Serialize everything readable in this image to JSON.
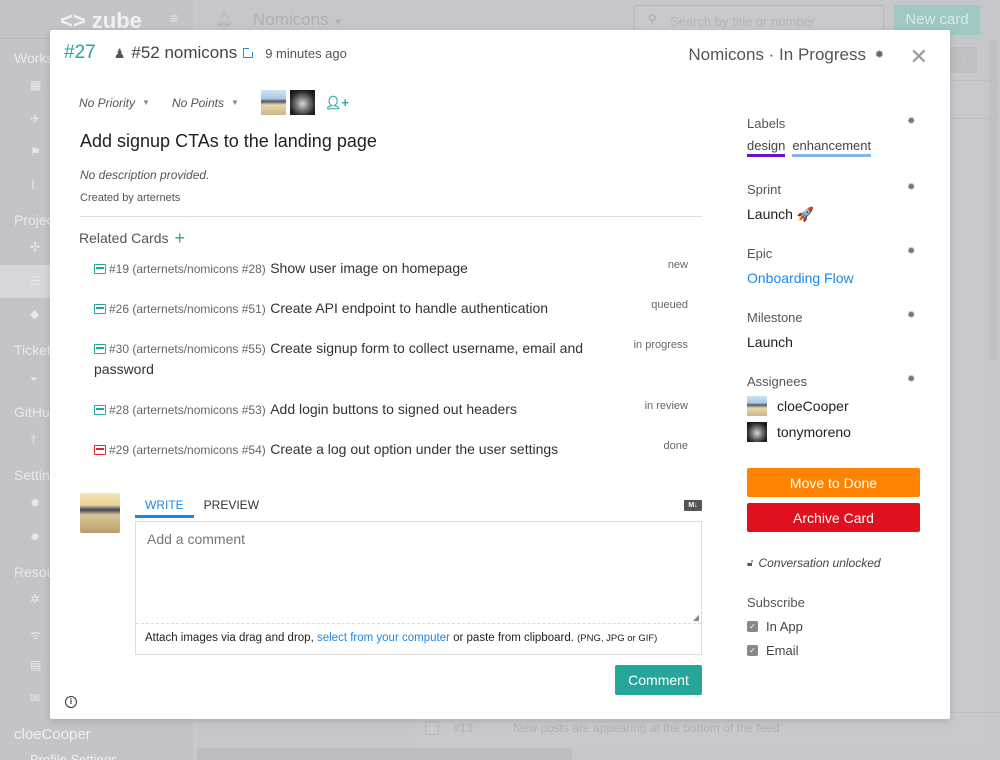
{
  "app": {
    "brand": "<> zube",
    "sidebar_sections": [
      "Works",
      "Projec",
      "Ticket",
      "GitHu",
      "Settin",
      "Resou"
    ],
    "sidebar_user": "cloeCooper",
    "sidebar_profile": "Profile Settings",
    "topbar_project": "Nomicons",
    "search_placeholder": "Search by title or number",
    "new_card_label": "New card",
    "bg_row": {
      "number": "#13",
      "title": "New posts are appearing at the bottom of the feed"
    }
  },
  "card": {
    "number": "#27",
    "github_issue": "#52 nomicons",
    "time_ago": "9 minutes ago",
    "status": "Nomicons · In Progress",
    "priority": "No Priority",
    "points": "No Points",
    "title": "Add signup CTAs to the landing page",
    "description": "No description provided.",
    "created_by": "Created by arternets"
  },
  "related": {
    "header": "Related Cards",
    "items": [
      {
        "ref": "#19 (arternets/nomicons #28)",
        "title": "Show user image on homepage",
        "status": "new",
        "state": "open"
      },
      {
        "ref": "#26 (arternets/nomicons #51)",
        "title": "Create API endpoint to handle authentication",
        "status": "queued",
        "state": "open"
      },
      {
        "ref": "#30 (arternets/nomicons #55)",
        "title": "Create signup form to collect username, email and password",
        "status": "in progress",
        "state": "open"
      },
      {
        "ref": "#28 (arternets/nomicons #53)",
        "title": "Add login buttons to signed out headers",
        "status": "in review",
        "state": "open"
      },
      {
        "ref": "#29 (arternets/nomicons #54)",
        "title": "Create a log out option under the user settings",
        "status": "done",
        "state": "closed"
      }
    ]
  },
  "comment": {
    "tab_write": "WRITE",
    "tab_preview": "PREVIEW",
    "markdown_badge": "M↓",
    "placeholder": "Add a comment",
    "value": "",
    "attach_prefix": "Attach images via drag and drop, ",
    "attach_link": "select from your computer",
    "attach_suffix": " or paste from clipboard. ",
    "attach_types": "(PNG, JPG or GIF)",
    "submit_label": "Comment"
  },
  "panel": {
    "labels_title": "Labels",
    "labels": [
      {
        "name": "design",
        "color": "#6a11cb"
      },
      {
        "name": "enhancement",
        "color": "#84b6eb"
      }
    ],
    "sprint_title": "Sprint",
    "sprint_value": "Launch 🚀",
    "epic_title": "Epic",
    "epic_value": "Onboarding Flow",
    "milestone_title": "Milestone",
    "milestone_value": "Launch",
    "assignees_title": "Assignees",
    "assignees": [
      "cloeCooper",
      "tonymoreno"
    ],
    "move_button": "Move to Done",
    "archive_button": "Archive Card",
    "conversation": "Conversation unlocked",
    "subscribe_title": "Subscribe",
    "subscribe_options": [
      {
        "label": "In App",
        "checked": true
      },
      {
        "label": "Email",
        "checked": true
      }
    ]
  },
  "colors": {
    "accent": "#26a69a",
    "link": "#1e88e5",
    "move_done": "#ff8300",
    "archive": "#e0101f",
    "closed_card": "#e0202d"
  }
}
